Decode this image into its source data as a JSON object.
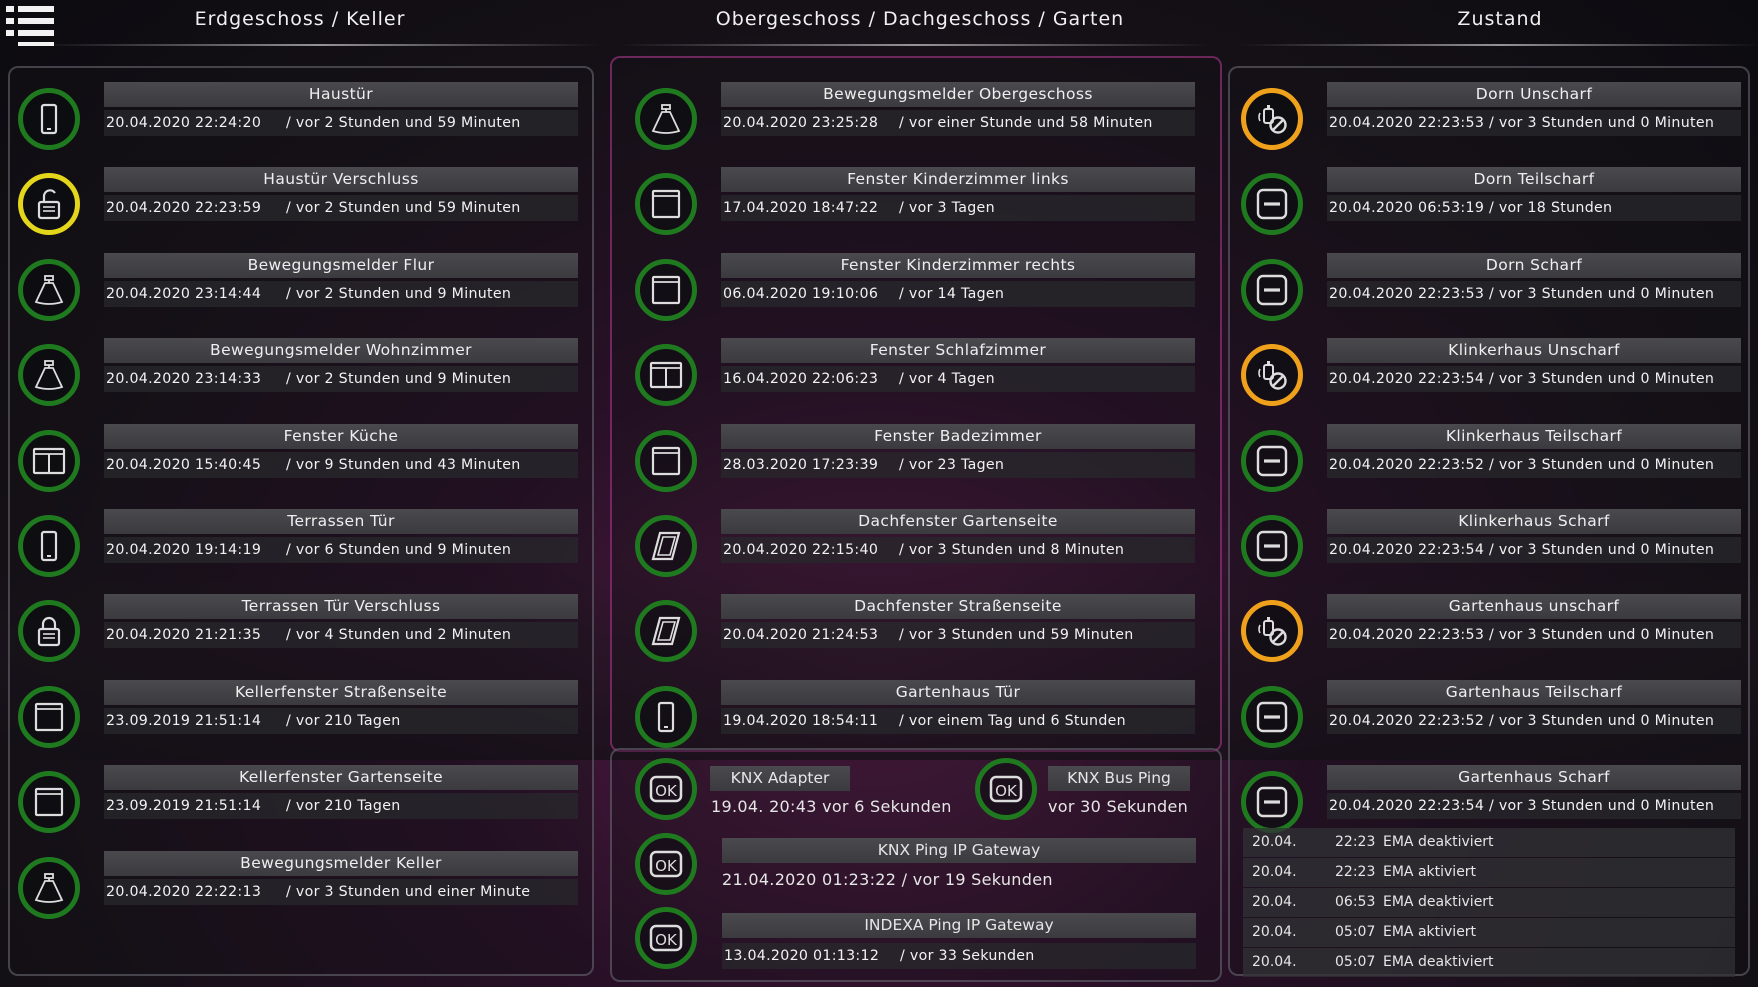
{
  "columns": {
    "left_title": "Erdgeschoss / Keller",
    "middle_title": "Obergeschoss / Dachgeschoss / Garten",
    "right_title": "Zustand"
  },
  "left_rows": [
    {
      "label": "Haustür",
      "time": "20.04.2020 22:24:20",
      "rel": "/ vor 2 Stunden und 59 Minuten",
      "icon": "door-icon",
      "ring": "green"
    },
    {
      "label": "Haustür Verschluss",
      "time": "20.04.2020 22:23:59",
      "rel": "/ vor 2 Stunden und 59 Minuten",
      "icon": "unlocked-icon",
      "ring": "yellow"
    },
    {
      "label": "Bewegungsmelder Flur",
      "time": "20.04.2020 23:14:44",
      "rel": "/ vor 2 Stunden und 9 Minuten",
      "icon": "motion-sensor-icon",
      "ring": "green"
    },
    {
      "label": "Bewegungsmelder Wohnzimmer",
      "time": "20.04.2020 23:14:33",
      "rel": "/ vor 2 Stunden und 9 Minuten",
      "icon": "motion-sensor-icon",
      "ring": "green"
    },
    {
      "label": "Fenster Küche",
      "time": "20.04.2020 15:40:45",
      "rel": "/ vor 9 Stunden und 43 Minuten",
      "icon": "double-window-icon",
      "ring": "green"
    },
    {
      "label": "Terrassen Tür",
      "time": "20.04.2020 19:14:19",
      "rel": "/ vor 6 Stunden und 9 Minuten",
      "icon": "door-icon",
      "ring": "green"
    },
    {
      "label": "Terrassen Tür Verschluss",
      "time": "20.04.2020 21:21:35",
      "rel": "/ vor 4 Stunden und 2 Minuten",
      "icon": "locked-icon",
      "ring": "green"
    },
    {
      "label": "Kellerfenster Straßenseite",
      "time": "23.09.2019 21:51:14",
      "rel": "/ vor 210 Tagen",
      "icon": "window-icon",
      "ring": "green"
    },
    {
      "label": "Kellerfenster Gartenseite",
      "time": "23.09.2019 21:51:14",
      "rel": "/ vor 210 Tagen",
      "icon": "window-icon",
      "ring": "green"
    },
    {
      "label": "Bewegungsmelder Keller",
      "time": "20.04.2020 22:22:13",
      "rel": "/ vor 3 Stunden und einer Minute",
      "icon": "motion-sensor-icon",
      "ring": "green"
    }
  ],
  "middle_rows": [
    {
      "label": "Bewegungsmelder Obergeschoss",
      "time": "20.04.2020 23:25:28",
      "rel": "/ vor einer Stunde und 58 Minuten",
      "icon": "motion-sensor-icon",
      "ring": "green"
    },
    {
      "label": "Fenster Kinderzimmer links",
      "time": "17.04.2020 18:47:22",
      "rel": "/ vor 3 Tagen",
      "icon": "window-icon",
      "ring": "green"
    },
    {
      "label": "Fenster Kinderzimmer rechts",
      "time": "06.04.2020 19:10:06",
      "rel": "/ vor 14 Tagen",
      "icon": "window-icon",
      "ring": "green"
    },
    {
      "label": "Fenster Schlafzimmer",
      "time": "16.04.2020 22:06:23",
      "rel": "/ vor 4 Tagen",
      "icon": "double-window-icon",
      "ring": "green"
    },
    {
      "label": "Fenster Badezimmer",
      "time": "28.03.2020 17:23:39",
      "rel": "/ vor 23 Tagen",
      "icon": "window-icon",
      "ring": "green"
    },
    {
      "label": "Dachfenster Gartenseite",
      "time": "20.04.2020 22:15:40",
      "rel": "/ vor 3 Stunden und 8 Minuten",
      "icon": "roof-window-icon",
      "ring": "green"
    },
    {
      "label": "Dachfenster Straßenseite",
      "time": "20.04.2020 21:24:53",
      "rel": "/ vor 3 Stunden und 59 Minuten",
      "icon": "roof-window-icon",
      "ring": "green"
    },
    {
      "label": "Gartenhaus Tür",
      "time": "19.04.2020 18:54:11",
      "rel": "/ vor einem Tag und 6 Stunden",
      "icon": "door-icon",
      "ring": "green"
    }
  ],
  "ok": {
    "knx_adapter": {
      "label": "KNX Adapter",
      "info": "19.04. 20:43  vor 6 Sekunden",
      "icon_text": "OK"
    },
    "knx_bus_ping": {
      "label": "KNX Bus Ping",
      "info": "vor 30 Sekunden",
      "icon_text": "OK"
    },
    "knx_ping_ip": {
      "label": "KNX Ping IP Gateway",
      "info": "21.04.2020 01:23:22  / vor 19 Sekunden",
      "icon_text": "OK"
    },
    "indexa_ping_ip": {
      "label": "INDEXA Ping IP Gateway",
      "time": "13.04.2020 01:13:12",
      "rel": "/ vor 33 Sekunden",
      "icon_text": "OK"
    }
  },
  "right_rows": [
    {
      "label": "Dorn Unscharf",
      "info": "20.04.2020 22:23:53 / vor 3 Stunden und 0 Minuten",
      "icon": "alarm-disabled-icon",
      "ring": "orange"
    },
    {
      "label": "Dorn Teilscharf",
      "info": "20.04.2020 06:53:19 / vor 18 Stunden",
      "icon": "minus-icon",
      "ring": "green"
    },
    {
      "label": "Dorn Scharf",
      "info": "20.04.2020 22:23:53 / vor 3 Stunden und 0 Minuten",
      "icon": "minus-icon",
      "ring": "green"
    },
    {
      "label": "Klinkerhaus Unscharf",
      "info": "20.04.2020 22:23:54 / vor 3 Stunden und 0 Minuten",
      "icon": "alarm-disabled-icon",
      "ring": "orange"
    },
    {
      "label": "Klinkerhaus Teilscharf",
      "info": "20.04.2020 22:23:52 / vor 3 Stunden und 0 Minuten",
      "icon": "minus-icon",
      "ring": "green"
    },
    {
      "label": "Klinkerhaus Scharf",
      "info": "20.04.2020 22:23:54 / vor 3 Stunden und 0 Minuten",
      "icon": "minus-icon",
      "ring": "green"
    },
    {
      "label": "Gartenhaus unscharf",
      "info": "20.04.2020 22:23:53 / vor 3 Stunden und 0 Minuten",
      "icon": "alarm-disabled-icon",
      "ring": "orange"
    },
    {
      "label": "Gartenhaus Teilscharf",
      "info": "20.04.2020 22:23:52 / vor 3 Stunden und 0 Minuten",
      "icon": "minus-icon",
      "ring": "green"
    },
    {
      "label": "Gartenhaus Scharf",
      "info": "20.04.2020 22:23:54 / vor 3 Stunden und 0 Minuten",
      "icon": "minus-icon",
      "ring": "green"
    }
  ],
  "log": [
    {
      "date": "20.04.",
      "time": "22:23",
      "text": "EMA deaktiviert"
    },
    {
      "date": "20.04.",
      "time": "22:23",
      "text": "EMA aktiviert"
    },
    {
      "date": "20.04.",
      "time": "06:53",
      "text": "EMA deaktiviert"
    },
    {
      "date": "20.04.",
      "time": "05:07",
      "text": "EMA aktiviert"
    },
    {
      "date": "20.04.",
      "time": "05:07",
      "text": "EMA deaktiviert"
    }
  ],
  "colors": {
    "green": "#1f7a1f",
    "yellow": "#e3d61b",
    "orange": "#f0a11c"
  }
}
